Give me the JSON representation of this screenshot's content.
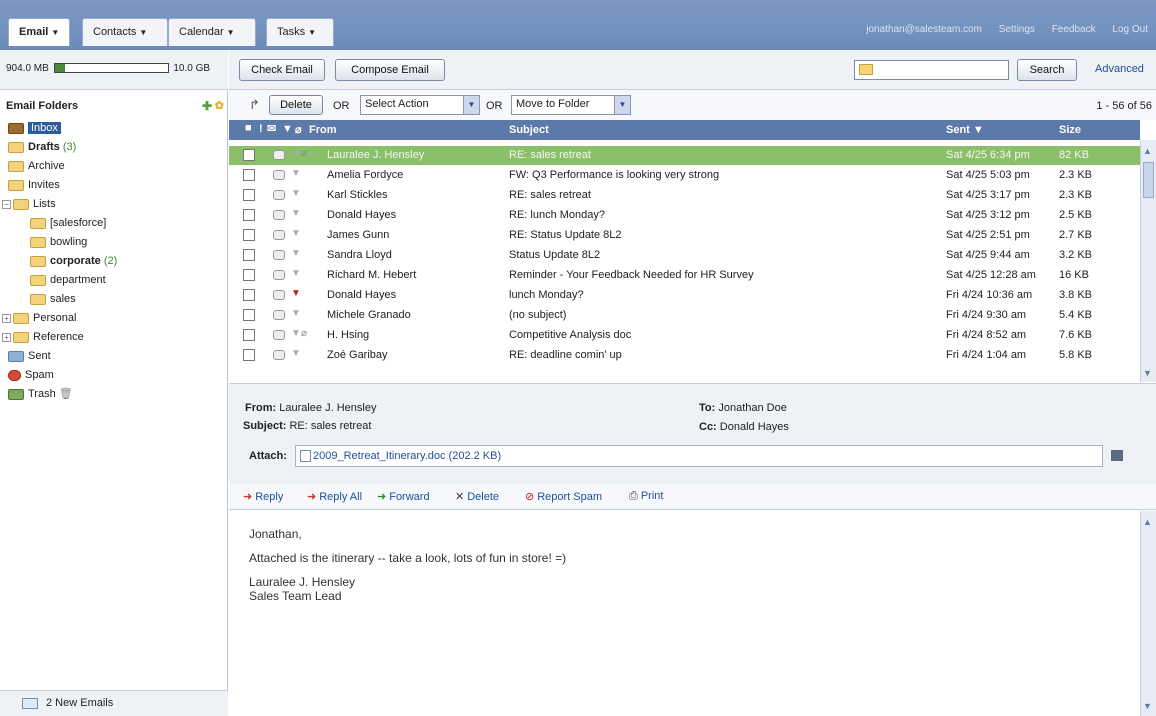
{
  "nav": {
    "tabs": [
      {
        "label": "Email"
      },
      {
        "label": "Contacts"
      },
      {
        "label": "Calendar"
      },
      {
        "label": "Tasks"
      }
    ],
    "links": {
      "user": "jonathan@salesteam.com",
      "settings": "Settings",
      "feedback": "Feedback",
      "logout": "Log Out"
    }
  },
  "quota": {
    "used": "904.0 MB",
    "total": "10.0 GB",
    "used_fraction": 0.09
  },
  "sidebar": {
    "heading": "Email Folders",
    "folders": [
      {
        "label": "Inbox",
        "icon": "inbox-icon"
      },
      {
        "label": "Drafts",
        "count": "(3)",
        "icon": "drafts-icon"
      },
      {
        "label": "Archive",
        "icon": "folder-icon"
      },
      {
        "label": "Invites",
        "icon": "folder-icon"
      },
      {
        "label": "Lists",
        "icon": "folder-icon",
        "expander": "−"
      },
      {
        "label": "[salesforce]",
        "icon": "folder-icon"
      },
      {
        "label": "bowling",
        "icon": "folder-icon"
      },
      {
        "label": "corporate",
        "count": "(2)",
        "icon": "folder-icon"
      },
      {
        "label": "department",
        "icon": "folder-icon"
      },
      {
        "label": "sales",
        "icon": "folder-icon"
      },
      {
        "label": "Personal",
        "icon": "folder-icon",
        "expander": "+"
      },
      {
        "label": "Reference",
        "icon": "folder-icon",
        "expander": "+"
      },
      {
        "label": "Sent",
        "icon": "sent-icon"
      },
      {
        "label": "Spam",
        "icon": "spam-icon"
      },
      {
        "label": "Trash",
        "icon": "trash-icon"
      }
    ],
    "new_emails": "2 New Emails"
  },
  "toolbar": {
    "check_email": "Check Email",
    "compose_email": "Compose Email",
    "search_value": "",
    "search_button": "Search",
    "advanced": "Advanced"
  },
  "actions": {
    "delete": "Delete",
    "or1": "OR",
    "select_action": "Select Action",
    "or2": "OR",
    "move_to_folder": "Move to Folder",
    "range": "1 - 56 of 56"
  },
  "list": {
    "columns": {
      "from": "From",
      "subject": "Subject",
      "sent": "Sent ▼",
      "size": "Size"
    },
    "rows": [
      {
        "from": "Lauralee J. Hensley",
        "subject": "RE: sales retreat",
        "sent": "Sat 4/25 6:34 pm",
        "size": "82 KB",
        "selected": true,
        "attach": true,
        "flag": ""
      },
      {
        "from": "Amelia Fordyce",
        "subject": "FW: Q3 Performance is looking very strong",
        "sent": "Sat 4/25 5:03 pm",
        "size": "2.3 KB",
        "attach": false,
        "flag": ""
      },
      {
        "from": "Karl Stickles",
        "subject": "RE: sales retreat",
        "sent": "Sat 4/25 3:17 pm",
        "size": "2.3 KB",
        "attach": false,
        "flag": ""
      },
      {
        "from": "Donald Hayes",
        "subject": "RE: lunch Monday?",
        "sent": "Sat 4/25 3:12 pm",
        "size": "2.5 KB",
        "attach": false,
        "flag": ""
      },
      {
        "from": "James Gunn",
        "subject": "RE: Status Update 8L2",
        "sent": "Sat 4/25 2:51 pm",
        "size": "2.7 KB",
        "attach": false,
        "flag": ""
      },
      {
        "from": "Sandra Lloyd",
        "subject": "Status Update 8L2",
        "sent": "Sat 4/25 9:44 am",
        "size": "3.2 KB",
        "attach": false,
        "flag": ""
      },
      {
        "from": "Richard M. Hebert",
        "subject": "Reminder - Your Feedback Needed  for HR Survey",
        "sent": "Sat 4/25 12:28 am",
        "size": "16 KB",
        "attach": false,
        "flag": ""
      },
      {
        "from": "Donald Hayes",
        "subject": "lunch Monday?",
        "sent": "Fri 4/24 10:36 am",
        "size": "3.8 KB",
        "attach": false,
        "flag": "red"
      },
      {
        "from": "Michele Granado",
        "subject": "(no subject)",
        "sent": "Fri 4/24 9:30 am",
        "size": "5.4 KB",
        "attach": false,
        "flag": ""
      },
      {
        "from": "H. Hsing",
        "subject": "Competitive Analysis doc",
        "sent": "Fri 4/24 8:52 am",
        "size": "7.6 KB",
        "attach": true,
        "flag": ""
      },
      {
        "from": "Zoé Garibay",
        "subject": "RE: deadline comin' up",
        "sent": "Fri 4/24 1:04 am",
        "size": "5.8 KB",
        "attach": false,
        "flag": ""
      }
    ]
  },
  "preview": {
    "from_label": "From:",
    "from": "Lauralee J. Hensley",
    "subject_label": "Subject:",
    "subject": "RE: sales retreat",
    "to_label": "To:",
    "to": "Jonathan Doe",
    "cc_label": "Cc:",
    "cc": "Donald Hayes",
    "attach_label": "Attach:",
    "attachment": "2009_Retreat_Itinerary.doc (202.2 KB)"
  },
  "reply_actions": {
    "reply": "Reply",
    "reply_all": "Reply All",
    "forward": "Forward",
    "delete": "Delete",
    "report_spam": "Report Spam",
    "print": "Print"
  },
  "body": {
    "greeting": "Jonathan,",
    "line1": "Attached is the itinerary -- take a look, lots of fun in store! =)",
    "sig_name": "Lauralee J. Hensley",
    "sig_title": "Sales Team Lead"
  },
  "colors": {
    "nav_blue": "#6c8bb9",
    "header_blue": "#5b7aa9",
    "selected_green": "#8bbf6a",
    "link_blue": "#224f99"
  }
}
